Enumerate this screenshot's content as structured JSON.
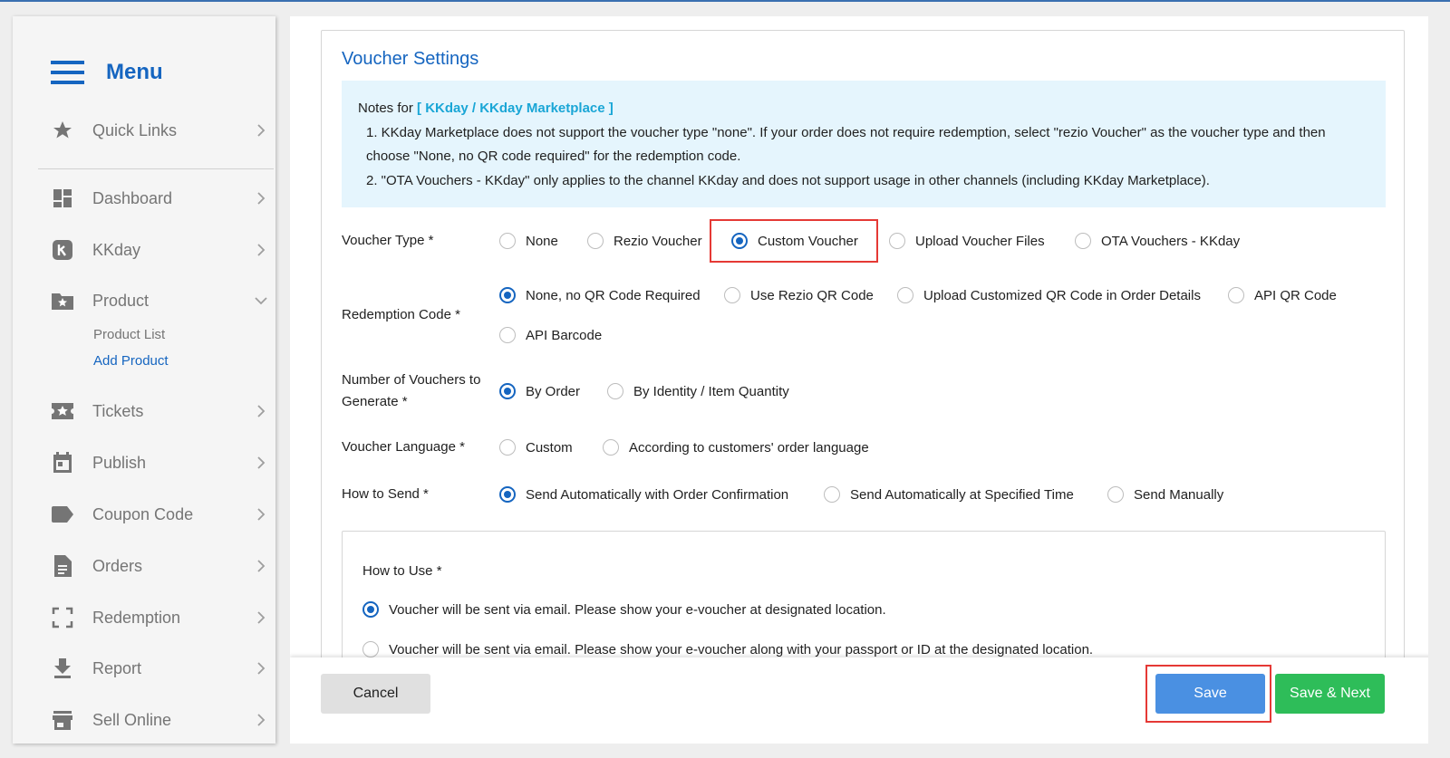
{
  "sidebar": {
    "title": "Menu",
    "items": [
      {
        "label": "Quick Links",
        "icon": "star-icon"
      },
      {
        "label": "Dashboard",
        "icon": "dashboard-icon"
      },
      {
        "label": "KKday",
        "icon": "kkday-icon"
      },
      {
        "label": "Product",
        "icon": "product-icon"
      },
      {
        "label": "Tickets",
        "icon": "ticket-icon"
      },
      {
        "label": "Publish",
        "icon": "calendar-icon"
      },
      {
        "label": "Coupon Code",
        "icon": "tag-icon"
      },
      {
        "label": "Orders",
        "icon": "document-icon"
      },
      {
        "label": "Redemption",
        "icon": "scan-icon"
      },
      {
        "label": "Report",
        "icon": "download-icon"
      },
      {
        "label": "Sell Online",
        "icon": "store-icon"
      }
    ],
    "product_sub": {
      "product_list": "Product List",
      "add_product": "Add Product"
    }
  },
  "voucher": {
    "title": "Voucher Settings",
    "notes": {
      "prefix": "Notes for",
      "highlight": "[ KKday / KKday Marketplace ]",
      "line1": "1. KKday Marketplace does not support the voucher type \"none\". If your order does not require redemption, select \"rezio Voucher\" as the voucher type and then choose \"None, no QR code required\" for the redemption code.",
      "line2": "2. \"OTA Vouchers - KKday\" only applies to the channel KKday and does not support usage in other channels (including KKday Marketplace)."
    },
    "voucher_type": {
      "label": "Voucher Type *",
      "options": [
        "None",
        "Rezio Voucher",
        "Custom Voucher",
        "Upload Voucher Files",
        "OTA Vouchers - KKday"
      ],
      "selected": "Custom Voucher"
    },
    "redemption_code": {
      "label": "Redemption Code *",
      "options": [
        "None, no QR Code Required",
        "Use Rezio QR Code",
        "Upload Customized QR Code in Order Details",
        "API QR Code",
        "API Barcode"
      ],
      "selected": "None, no QR Code Required"
    },
    "num_vouchers": {
      "label_line1": "Number of Vouchers to",
      "label_line2": "Generate *",
      "options": [
        "By Order",
        "By Identity / Item Quantity"
      ],
      "selected": "By Order"
    },
    "language": {
      "label": "Voucher Language *",
      "options": [
        "Custom",
        "According to customers' order language"
      ],
      "selected": "Custom"
    },
    "how_to_send": {
      "label": "How to Send *",
      "options": [
        "Send Automatically with Order Confirmation",
        "Send Automatically at Specified Time",
        "Send Manually"
      ],
      "selected": "Send Automatically with Order Confirmation"
    },
    "how_to_use": {
      "label": "How to Use *",
      "options": [
        "Voucher will be sent via email. Please show your e-voucher at designated location.",
        "Voucher will be sent via email. Please show your e-voucher along with your passport or ID at the designated location."
      ],
      "selected": "Voucher will be sent via email. Please show your e-voucher at designated location."
    }
  },
  "footer": {
    "cancel": "Cancel",
    "save": "Save",
    "save_next": "Save & Next"
  },
  "colors": {
    "accent": "#1565c0",
    "save": "#4a90e2",
    "save_next": "#2ebd59",
    "highlight": "#e53935"
  }
}
